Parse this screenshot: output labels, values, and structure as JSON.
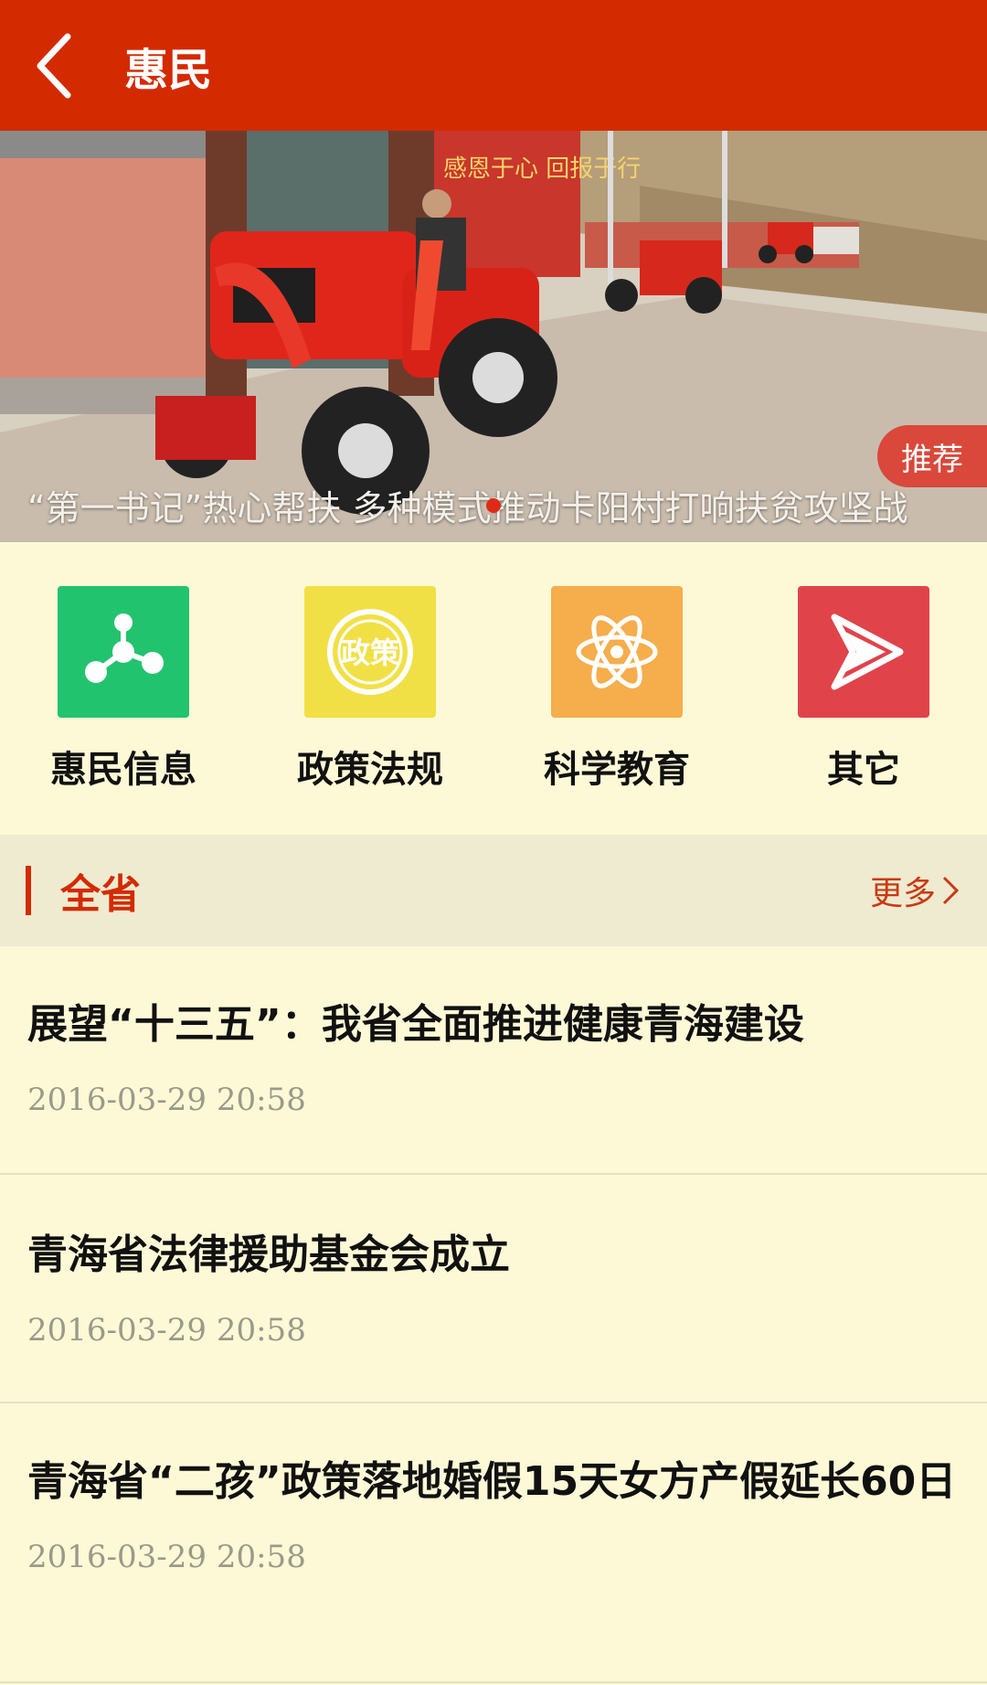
{
  "header": {
    "title": "惠民"
  },
  "banner": {
    "caption": "“第一书记”热心帮扶 多种模式推动卡阳村打响扶贫攻坚战",
    "badge": "推荐"
  },
  "categories": [
    {
      "label": "惠民信息",
      "icon": "share-nodes-icon",
      "color": "#22c36e"
    },
    {
      "label": "政策法规",
      "icon": "policy-stamp-icon",
      "color": "#f1e045",
      "icon_text": "政策"
    },
    {
      "label": "科学教育",
      "icon": "atom-icon",
      "color": "#f6ad4c"
    },
    {
      "label": "其它",
      "icon": "play-arrow-icon",
      "color": "#e0434a"
    }
  ],
  "section": {
    "title": "全省",
    "more": "更多"
  },
  "news": [
    {
      "title": "展望“十三五”：我省全面推进健康青海建设",
      "date": "2016-03-29 20:58"
    },
    {
      "title": "青海省法律援助基金会成立",
      "date": "2016-03-29 20:58"
    },
    {
      "title": "青海省“二孩”政策落地婚假15天女方产假延长60日",
      "date": "2016-03-29 20:58"
    }
  ],
  "colors": {
    "accent": "#d42a00",
    "background": "#fdf9d6"
  }
}
